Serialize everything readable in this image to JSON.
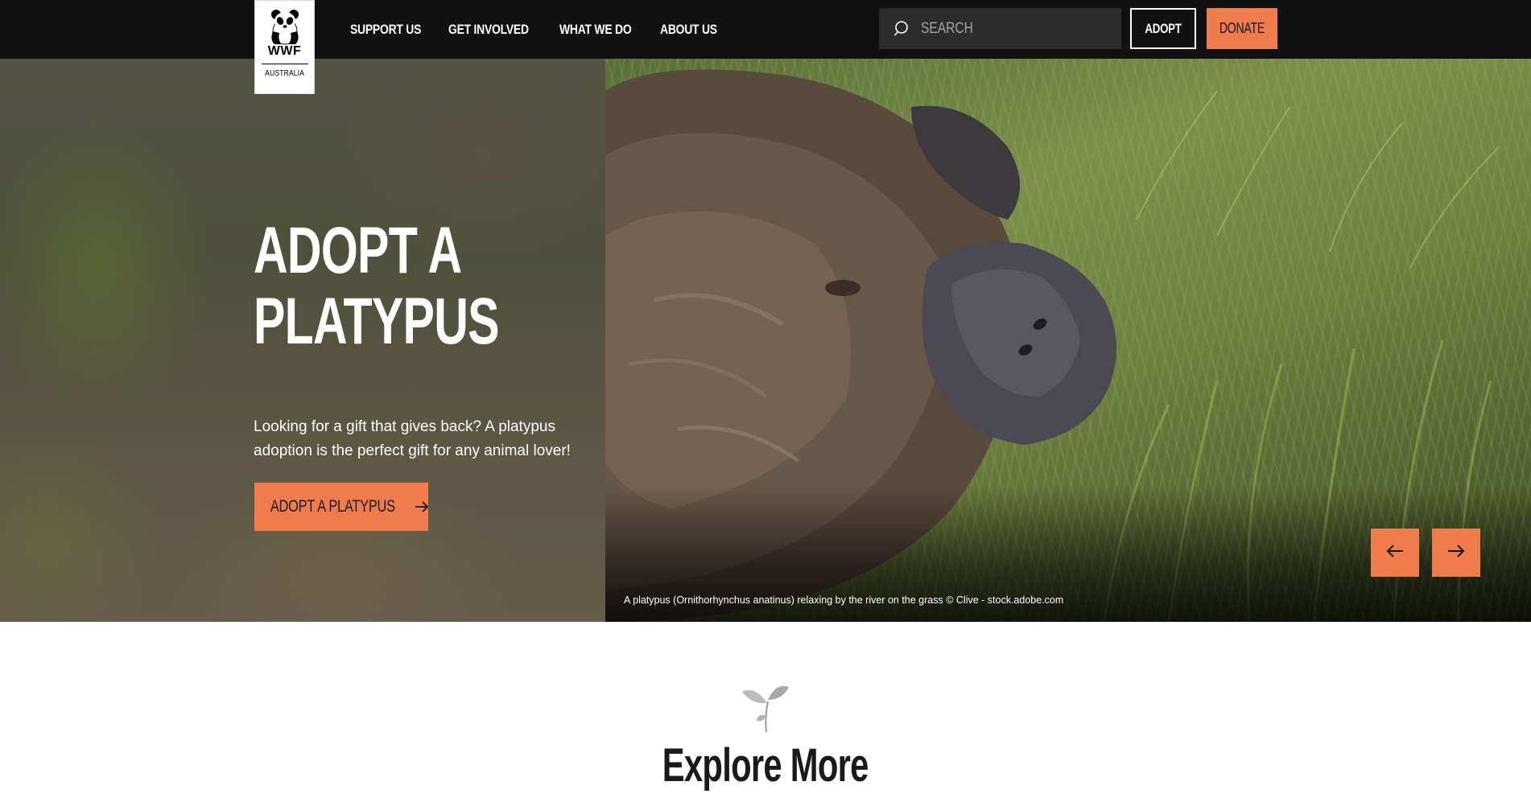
{
  "header": {
    "logo": {
      "brand": "WWF",
      "country": "AUSTRALIA"
    },
    "nav": [
      "SUPPORT US",
      "GET INVOLVED",
      "WHAT WE DO",
      "ABOUT US"
    ],
    "search": {
      "placeholder": "SEARCH",
      "icon": "search-icon"
    },
    "adopt_label": "ADOPT",
    "donate_label": "DONATE"
  },
  "hero": {
    "title": "ADOPT A PLATYPUS",
    "text": "Looking for a gift that gives back? A platypus adoption is the perfect gift for any animal lover!",
    "cta_label": "ADOPT A PLATYPUS",
    "cta_icon": "arrow-right-icon",
    "caption": "A platypus (Ornithorhynchus anatinus) relaxing by the river on the grass © Clive - stock.adobe.com",
    "prev_icon": "arrow-left-icon",
    "next_icon": "arrow-right-icon"
  },
  "explore": {
    "icon": "seedling-icon",
    "title": "Explore More"
  },
  "colors": {
    "topbar": "#111111",
    "accent": "#f07c4b",
    "white": "#ffffff",
    "search_bg": "#2c2c2c"
  }
}
